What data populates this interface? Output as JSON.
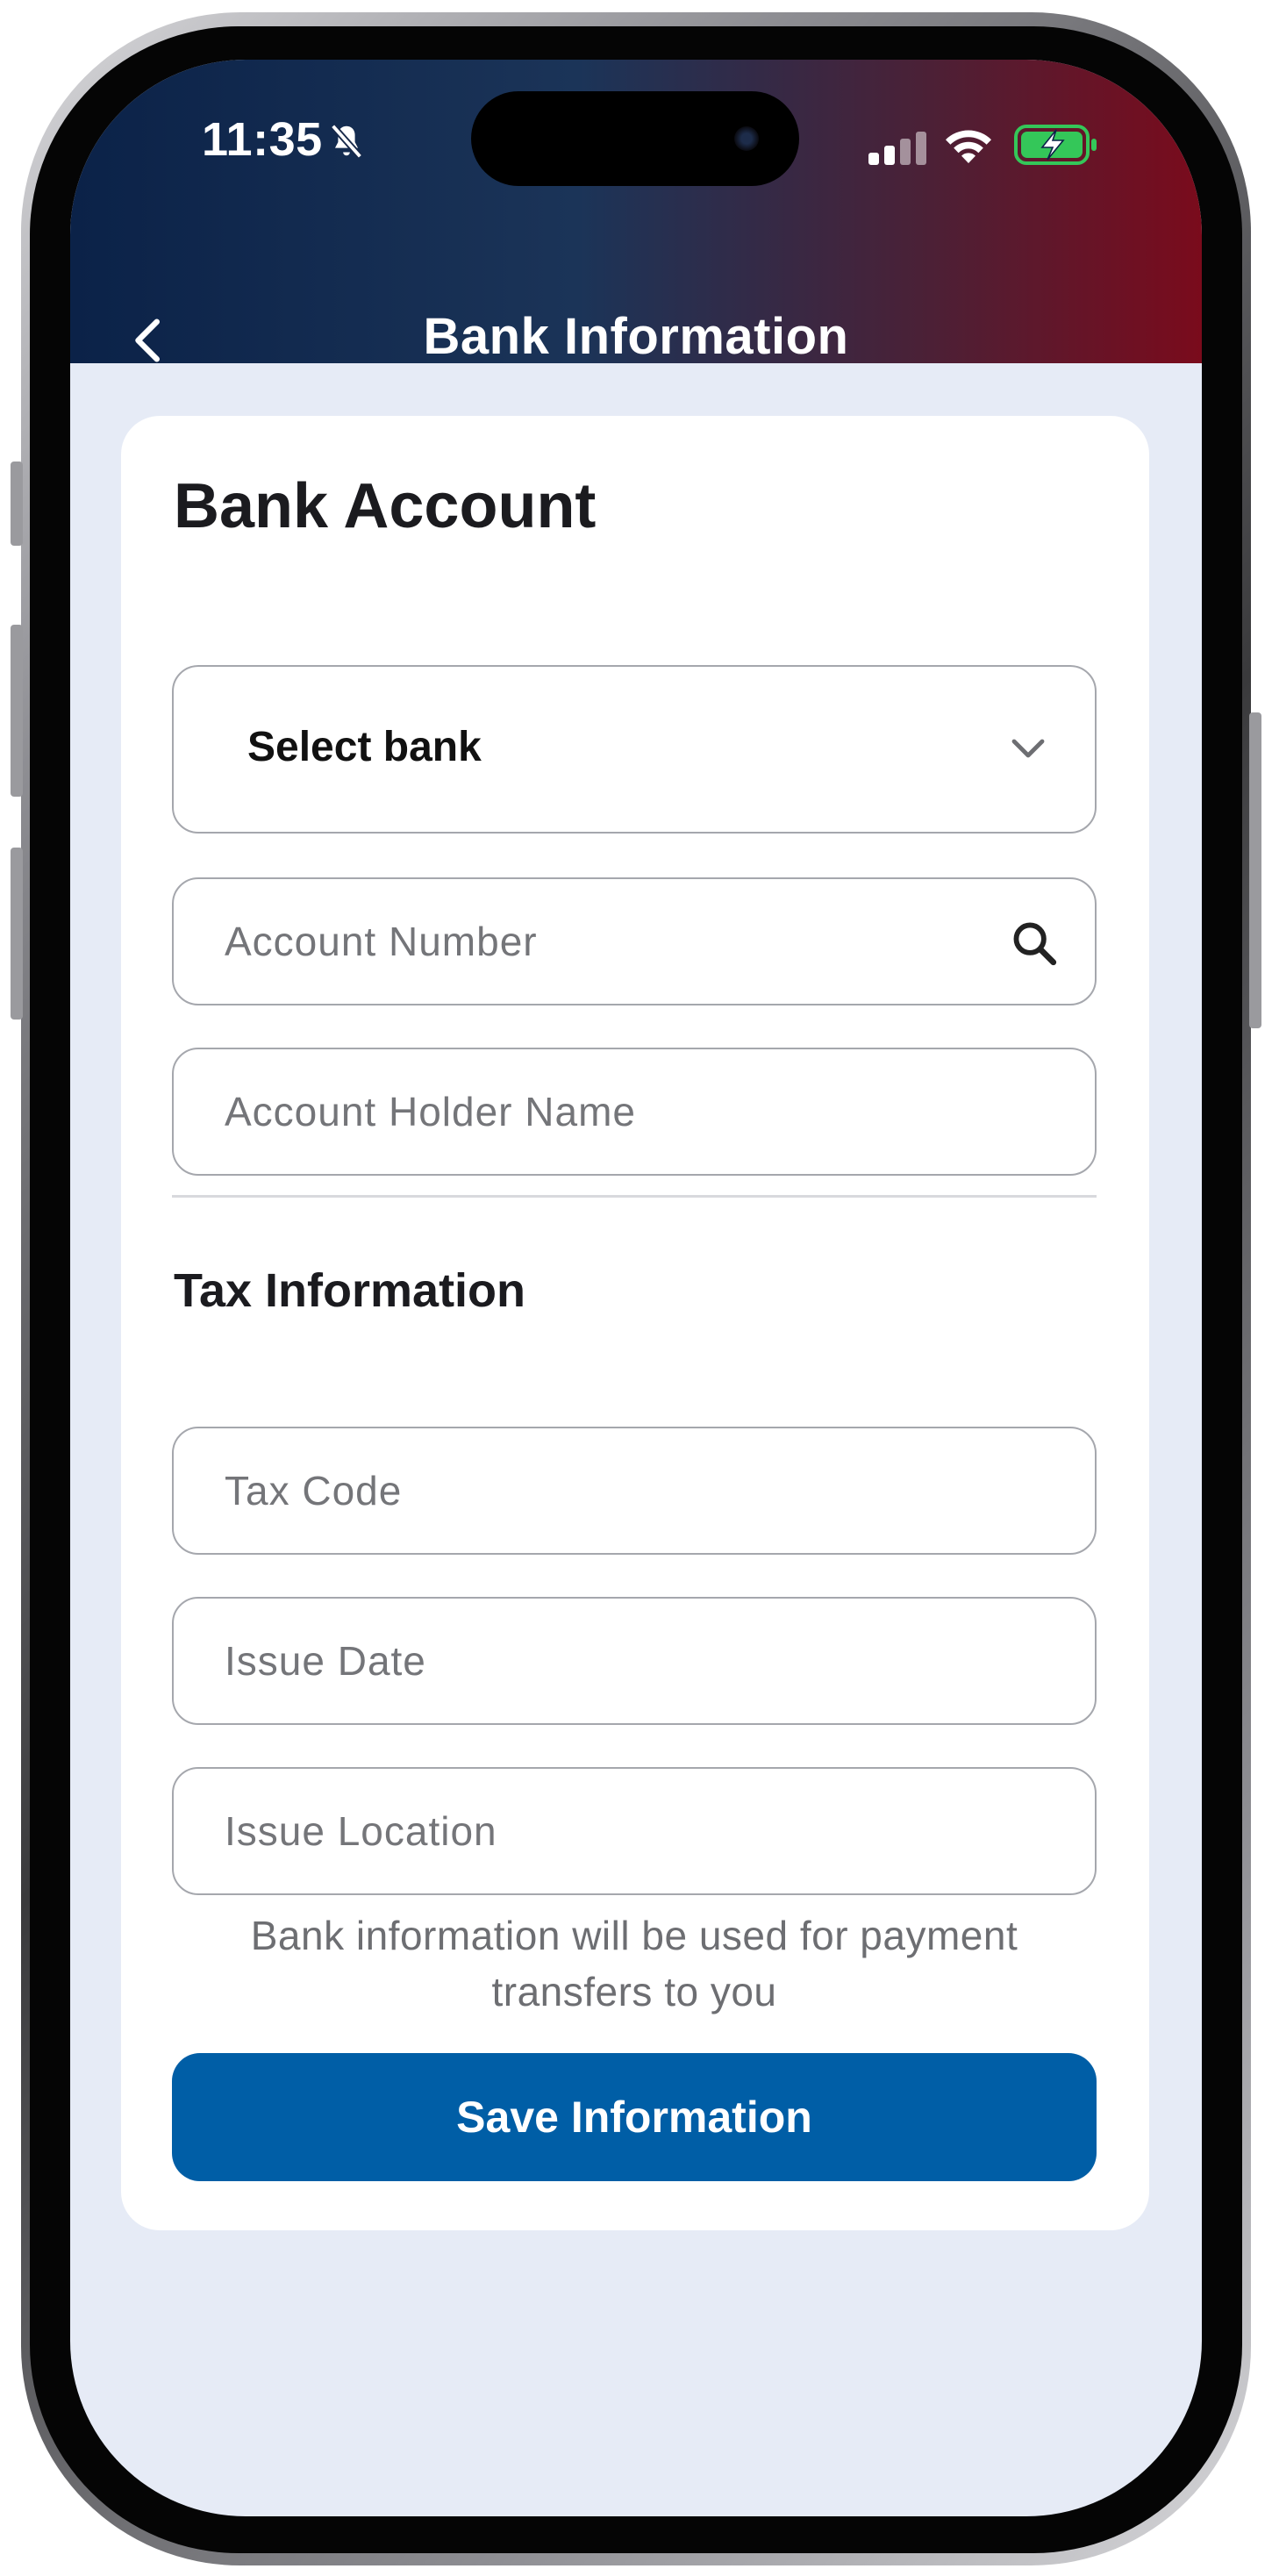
{
  "status_bar": {
    "time": "11:35",
    "icons": [
      "bell-slash-icon",
      "signal-icon",
      "wifi-icon",
      "battery-charging-icon"
    ]
  },
  "header": {
    "title": "Bank Information",
    "back_icon": "chevron-left-icon",
    "gradient_colors": [
      "#0b2248",
      "#7a0b1c"
    ]
  },
  "bank_account": {
    "title": "Bank Account",
    "select_bank_label": "Select bank",
    "account_number_placeholder": "Account Number",
    "account_holder_placeholder": "Account Holder Name"
  },
  "tax_information": {
    "title": "Tax Information",
    "tax_code_placeholder": "Tax Code",
    "issue_date_placeholder": "Issue Date",
    "issue_location_placeholder": "Issue Location"
  },
  "note": "Bank information will be used for payment transfers to you",
  "save_button": {
    "label": "Save Information",
    "color": "#005ea6"
  }
}
